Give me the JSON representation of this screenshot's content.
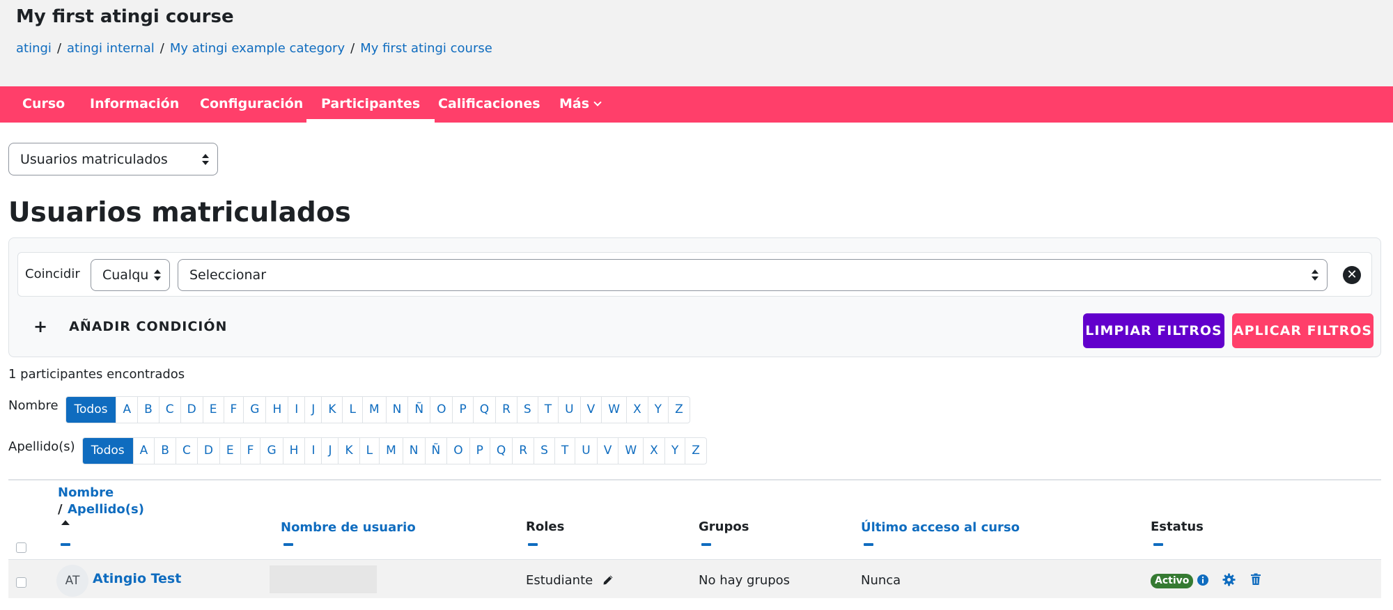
{
  "header": {
    "course_title": "My first atingi course",
    "breadcrumb": [
      "atingi",
      "atingi internal",
      "My atingi example category",
      "My first atingi course"
    ],
    "separator": "/"
  },
  "nav": {
    "items": [
      {
        "label": "Curso"
      },
      {
        "label": "Información"
      },
      {
        "label": "Configuración"
      },
      {
        "label": "Participantes"
      },
      {
        "label": "Calificaciones"
      },
      {
        "label": "Más"
      }
    ],
    "active": "Participantes"
  },
  "view_select": {
    "value": "Usuarios matriculados"
  },
  "page_heading": "Usuarios matriculados",
  "filters": {
    "match_label": "Coincidir",
    "match_value": "Cualqu",
    "condition_value": "Seleccionar",
    "add_condition_label": "AÑADIR CONDICIÓN",
    "clear_button": "LIMPIAR FILTROS",
    "apply_button": "APLICAR FILTROS"
  },
  "count_text": "1 participantes encontrados",
  "initials": {
    "first_name_label": "Nombre",
    "last_name_label": "Apellido(s)",
    "all_label": "Todos",
    "letters": [
      "A",
      "B",
      "C",
      "D",
      "E",
      "F",
      "G",
      "H",
      "I",
      "J",
      "K",
      "L",
      "M",
      "N",
      "Ñ",
      "O",
      "P",
      "Q",
      "R",
      "S",
      "T",
      "U",
      "V",
      "W",
      "X",
      "Y",
      "Z"
    ]
  },
  "table": {
    "headers": {
      "first_name": "Nombre",
      "slash": "/",
      "last_name": "Apellido(s)",
      "username": "Nombre de usuario",
      "roles": "Roles",
      "groups": "Grupos",
      "last_access": "Último acceso al curso",
      "status": "Estatus"
    },
    "rows": [
      {
        "initials": "AT",
        "name": "Atingio Test",
        "role": "Estudiante",
        "groups": "No hay grupos",
        "last_access": "Nunca",
        "status": "Activo"
      }
    ]
  },
  "colors": {
    "nav_bg": "#ff3f6a",
    "link": "#0f6cbf",
    "clear_btn": "#6200cc",
    "apply_btn": "#ff3f6a",
    "active_badge": "#357a32"
  }
}
